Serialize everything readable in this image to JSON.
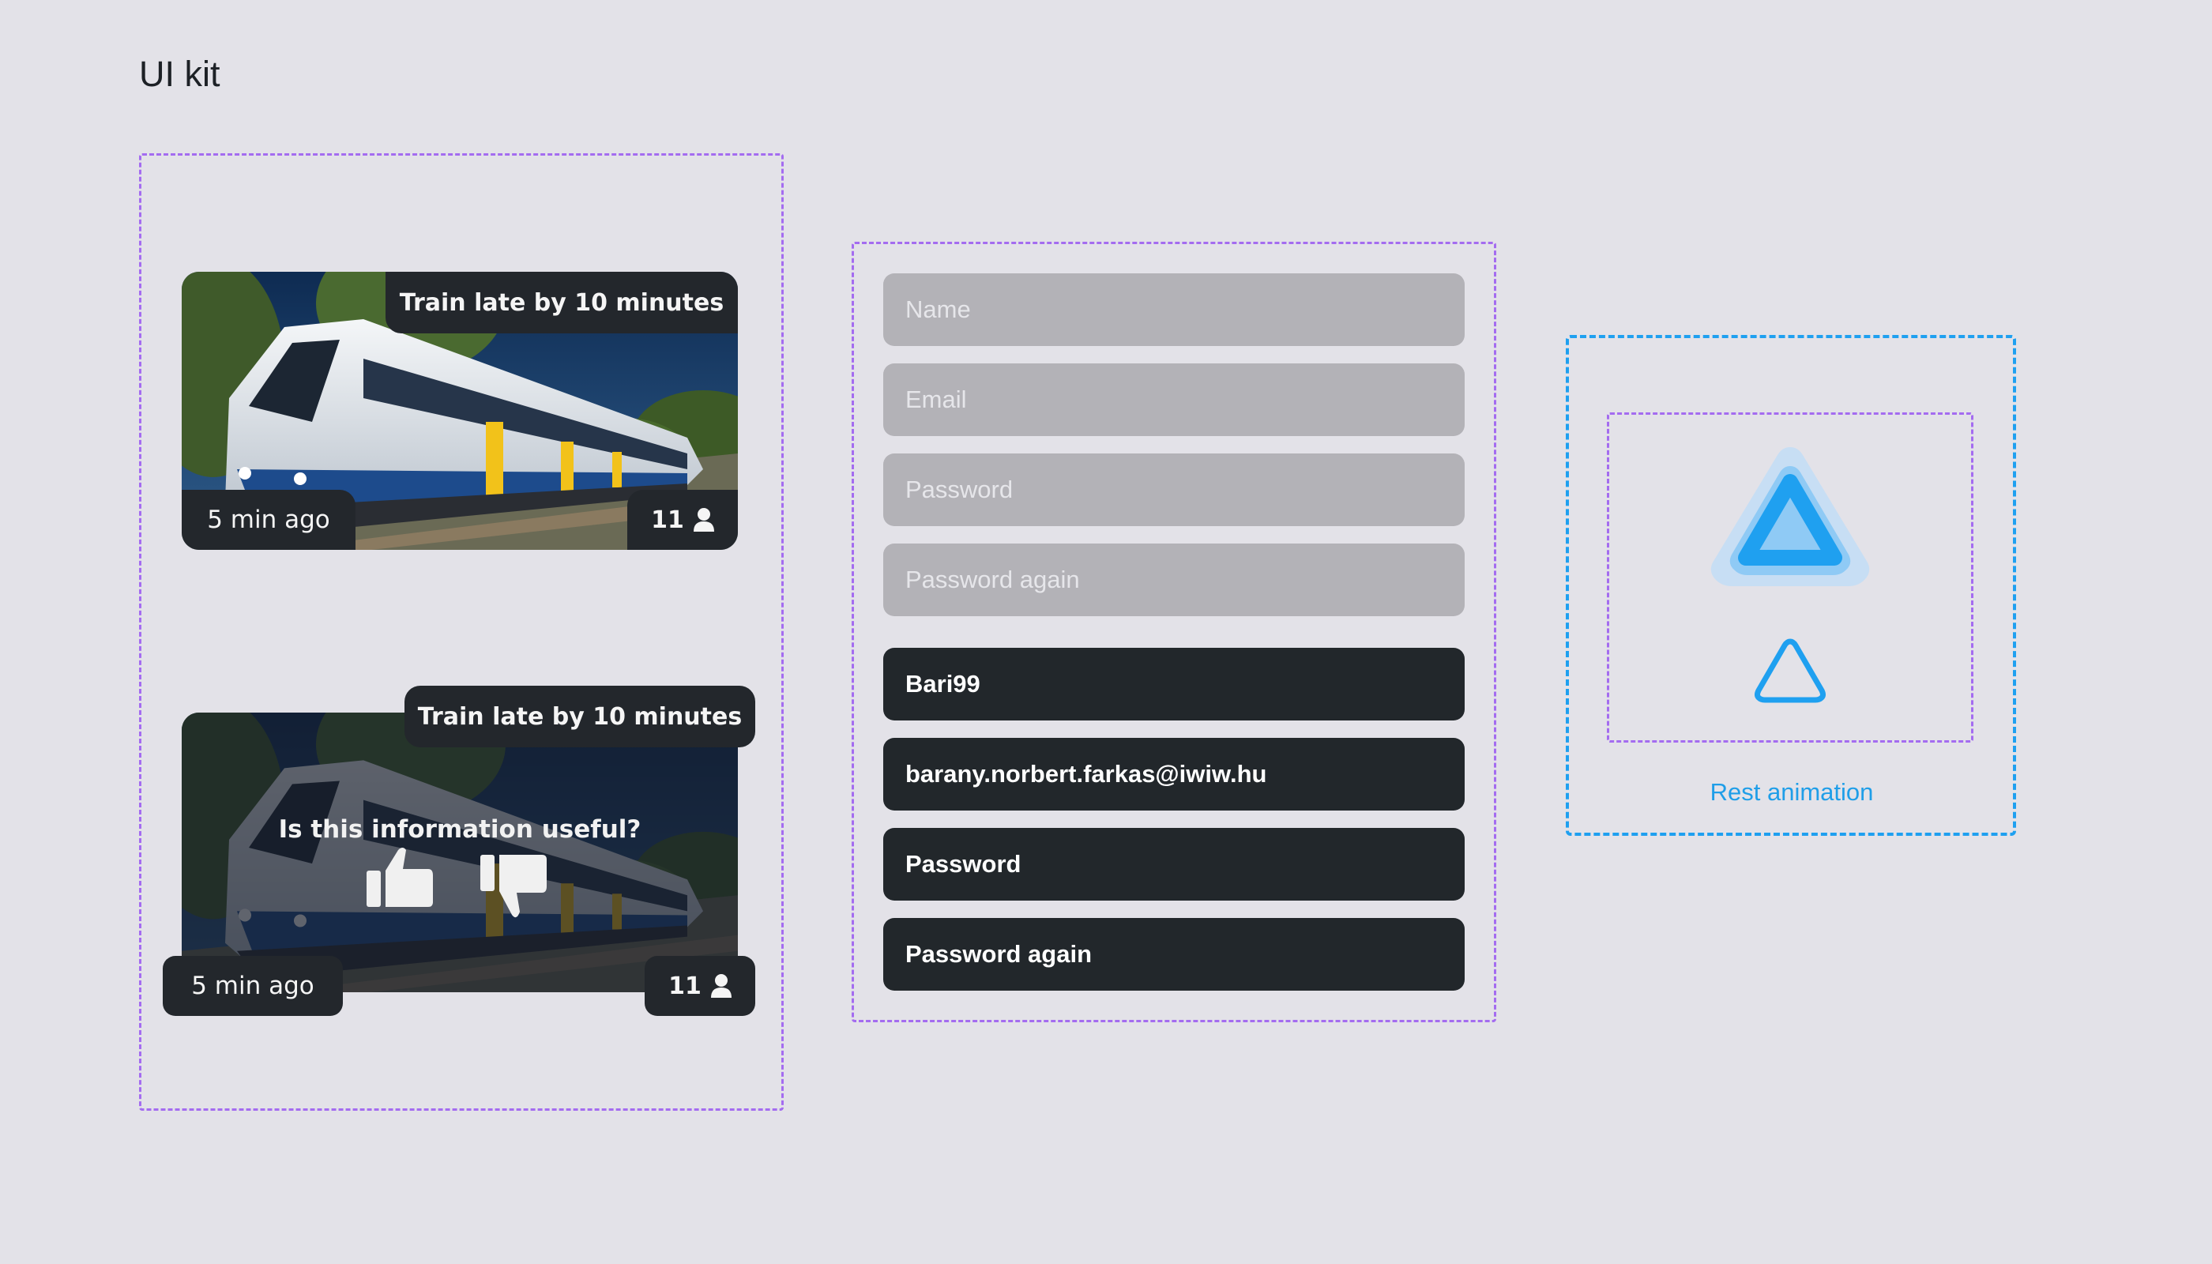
{
  "page": {
    "title": "UI kit"
  },
  "card_plain": {
    "title": "Train late by 10 minutes",
    "time": "5 min ago",
    "count": "11"
  },
  "card_feedback": {
    "title": "Train late by 10 minutes",
    "question": "Is this information useful?",
    "time": "5 min ago",
    "count": "11"
  },
  "form_empty": {
    "name_placeholder": "Name",
    "email_placeholder": "Email",
    "password_placeholder": "Password",
    "password_again_placeholder": "Password again"
  },
  "form_filled": {
    "name_value": "Bari99",
    "email_value": "barany.norbert.farkas@iwiw.hu",
    "password_value": "Password",
    "password_again_value": "Password again"
  },
  "animation": {
    "label": "Rest animation"
  },
  "colors": {
    "background": "#e3e2e8",
    "field_empty": "#b3b2b7",
    "field_filled": "#22272b",
    "accent_blue": "#1fa0f0",
    "dash_purple": "#a46cf0"
  },
  "icons": {
    "person": "person-icon",
    "thumbs_up": "thumbs-up-icon",
    "thumbs_down": "thumbs-down-icon",
    "triangle": "triangle-icon"
  }
}
